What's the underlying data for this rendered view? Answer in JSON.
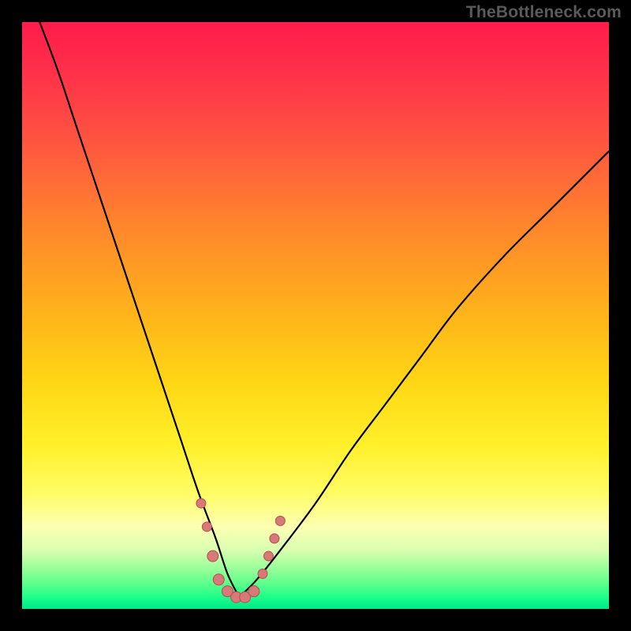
{
  "watermark": "TheBottleneck.com",
  "colors": {
    "frame": "#000000",
    "gradient_top": "#ff1c4b",
    "gradient_mid": "#ffd815",
    "gradient_bottom": "#00e888",
    "curve_stroke": "#000000",
    "marker_fill": "#d87878",
    "marker_stroke": "#b05050"
  },
  "chart_data": {
    "type": "line",
    "title": "",
    "xlabel": "",
    "ylabel": "",
    "xlim": [
      0,
      100
    ],
    "ylim": [
      0,
      100
    ],
    "notes": "Two smooth black curves on a vertical rainbow heat gradient. Left curve descends steeply from top-left to a trough near x≈37, y≈2; right curve rises from the trough toward upper-right. A cluster of salmon circular markers sits along the trough region.",
    "series": [
      {
        "name": "left-curve",
        "x": [
          3,
          6,
          9,
          12,
          15,
          18,
          21,
          24,
          27,
          30,
          33,
          35,
          37
        ],
        "values": [
          100,
          92,
          83,
          74,
          65,
          56,
          47,
          38,
          29,
          20,
          12,
          6,
          2
        ]
      },
      {
        "name": "right-curve",
        "x": [
          37,
          40,
          44,
          50,
          56,
          62,
          68,
          74,
          82,
          90,
          100
        ],
        "values": [
          2,
          5,
          10,
          18,
          27,
          35,
          43,
          51,
          60,
          68,
          78
        ]
      }
    ],
    "markers": [
      {
        "x": 30.5,
        "y": 18,
        "r": 6
      },
      {
        "x": 31.5,
        "y": 14,
        "r": 6
      },
      {
        "x": 32.5,
        "y": 9,
        "r": 7
      },
      {
        "x": 33.5,
        "y": 5,
        "r": 7
      },
      {
        "x": 35.0,
        "y": 3,
        "r": 7
      },
      {
        "x": 36.5,
        "y": 2,
        "r": 7
      },
      {
        "x": 38.0,
        "y": 2,
        "r": 7
      },
      {
        "x": 39.5,
        "y": 3,
        "r": 7
      },
      {
        "x": 41.0,
        "y": 6,
        "r": 6
      },
      {
        "x": 42.0,
        "y": 9,
        "r": 6
      },
      {
        "x": 43.0,
        "y": 12,
        "r": 6
      },
      {
        "x": 44.0,
        "y": 15,
        "r": 6
      }
    ]
  }
}
